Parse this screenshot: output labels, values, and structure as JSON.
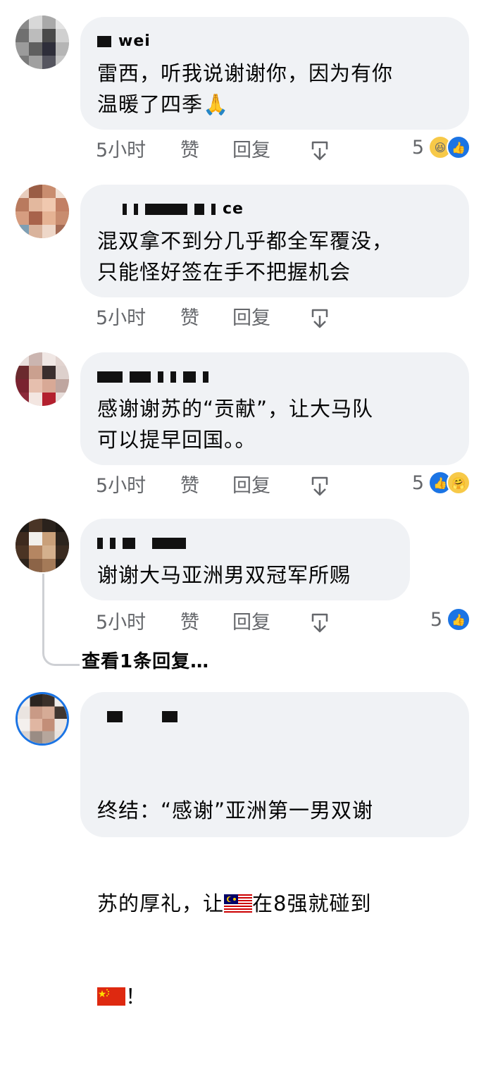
{
  "comments": [
    {
      "author": "wei",
      "text": "雷西，听我说谢谢你，因为有你\n温暖了四季🙏",
      "time": "5小时",
      "like": "赞",
      "reply": "回复",
      "reaction_count": "5",
      "reactions": [
        "haha-icon",
        "like-icon"
      ]
    },
    {
      "author": "ce",
      "text": "混双拿不到分几乎都全军覆没，\n只能怪好签在手不把握机会",
      "time": "5小时",
      "like": "赞",
      "reply": "回复",
      "reaction_count": "",
      "reactions": []
    },
    {
      "author": "",
      "text": "感谢谢苏的“贡献”，让大马队\n可以提早回国。。",
      "time": "5小时",
      "like": "赞",
      "reply": "回复",
      "reaction_count": "5",
      "reactions": [
        "like-icon",
        "care-icon"
      ]
    },
    {
      "author": "",
      "text": "谢谢大马亚洲男双冠军所赐",
      "time": "5小时",
      "like": "赞",
      "reply": "回复",
      "reaction_count": "5",
      "reactions": [
        "like-icon"
      ],
      "view_replies": "查看1条回复…"
    },
    {
      "author": "",
      "text_line1": "终结：“感谢”亚洲第一男双谢",
      "text_line2a": "苏的厚礼，让",
      "text_line2b": "在8强就碰到",
      "text_line3b": "！",
      "flags": [
        "malaysia-flag-icon",
        "china-flag-icon"
      ]
    }
  ],
  "colors": {
    "bubble": "#f0f2f5",
    "meta": "#65676b",
    "like_blue": "#1b74e4",
    "text": "#050505"
  }
}
